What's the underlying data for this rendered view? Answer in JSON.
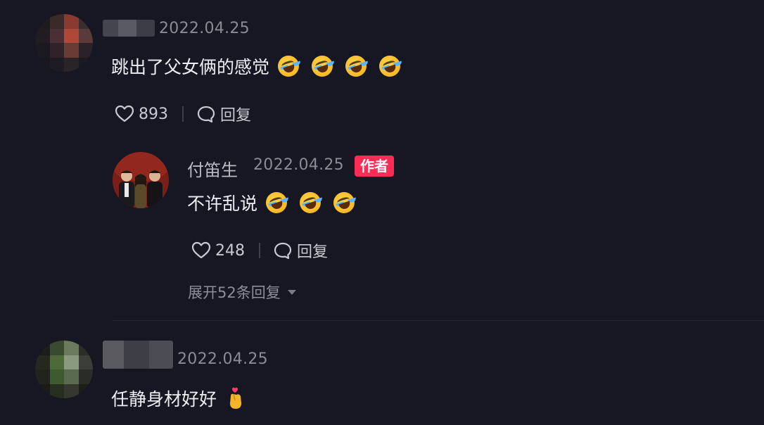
{
  "comments": [
    {
      "timestamp": "2022.04.25",
      "text": "跳出了父女俩的感觉",
      "emojis": [
        "rolling-on-floor-laughing",
        "rolling-on-floor-laughing",
        "rolling-on-floor-laughing",
        "rolling-on-floor-laughing"
      ],
      "likes": "893",
      "reply_label": "回复",
      "replies": [
        {
          "author": "付笛生",
          "timestamp": "2022.04.25",
          "badge": "作者",
          "text": "不许乱说",
          "emojis": [
            "rolling-on-floor-laughing",
            "rolling-on-floor-laughing",
            "rolling-on-floor-laughing"
          ],
          "likes": "248",
          "reply_label": "回复"
        }
      ],
      "expand_label": "展开52条回复"
    },
    {
      "timestamp": "2022.04.25",
      "text": "任静身材好好",
      "emojis": [
        "hand-with-index-finger-and-thumb-crossed"
      ]
    }
  ],
  "colors": {
    "background": "#161722",
    "badge": "#fe2c55",
    "muted_text": "#8a8b93"
  }
}
